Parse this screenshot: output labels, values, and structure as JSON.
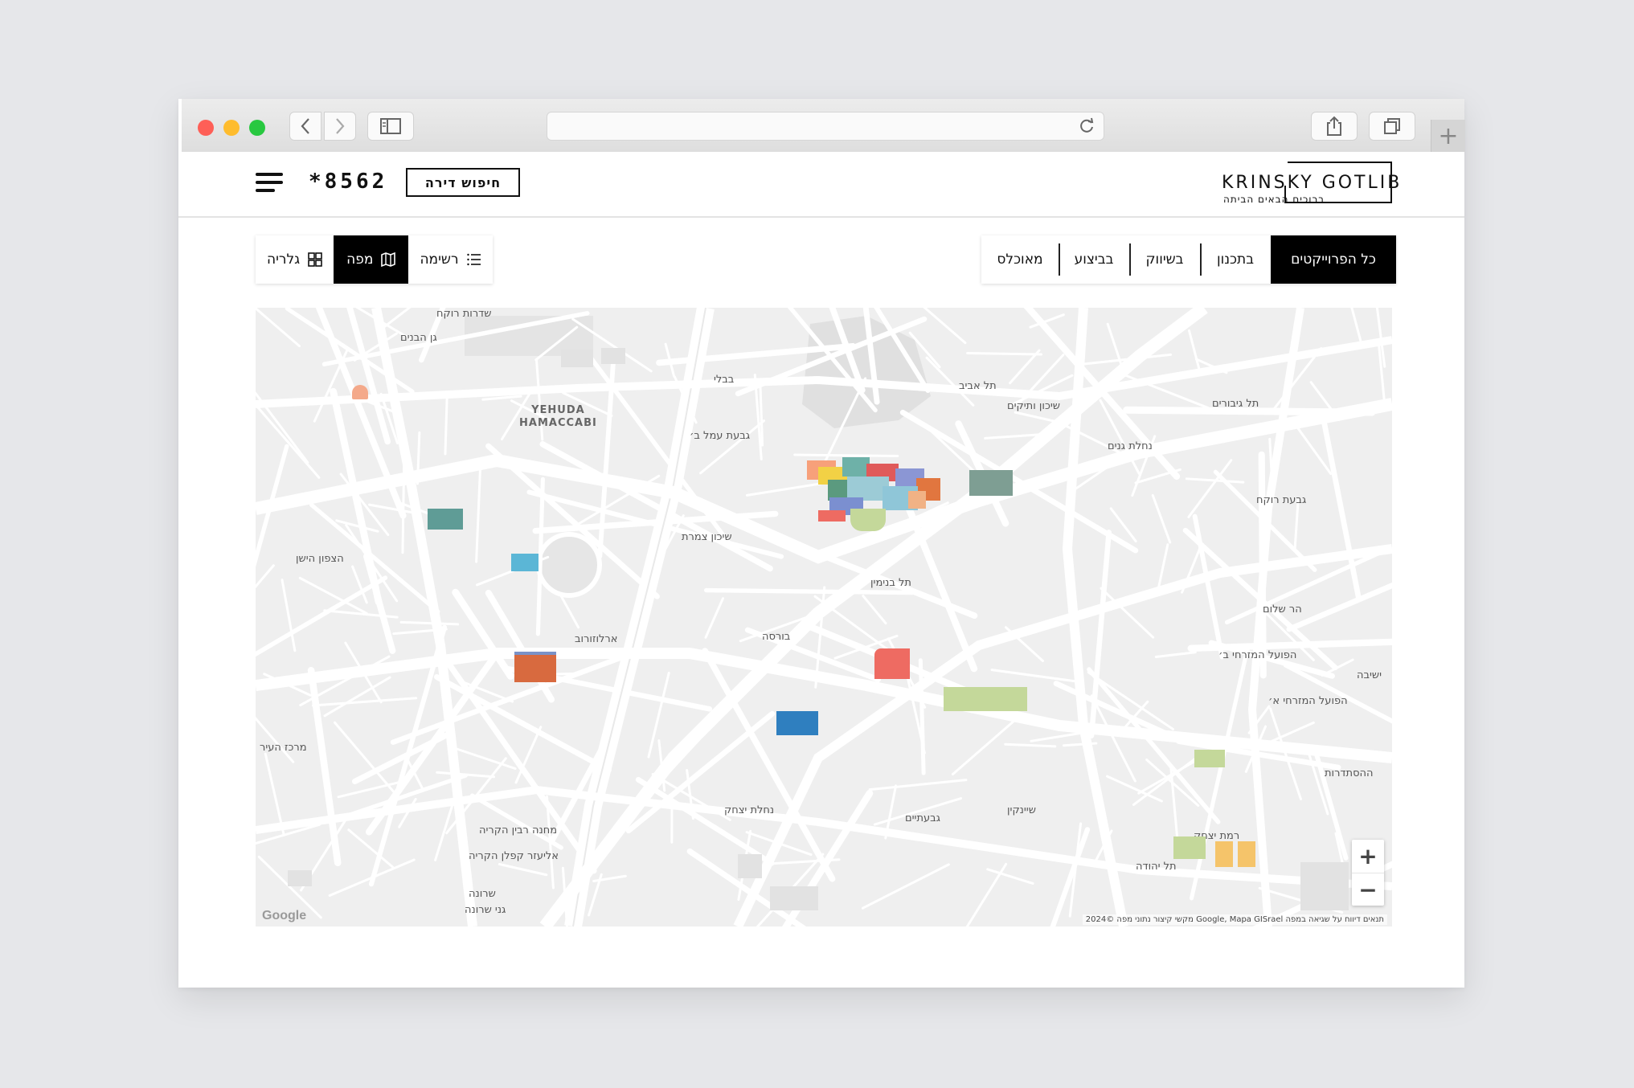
{
  "browser": {
    "url": "",
    "new_tab_symbol": "+"
  },
  "header": {
    "phone": "*8562",
    "search_button": "חיפוש דירה",
    "logo_name": "KRINSKY GOTLIB",
    "logo_tagline": "ברוכים הבאים הביתה"
  },
  "view_toggle": [
    {
      "label": "רשימה",
      "icon": "list-icon",
      "active": false
    },
    {
      "label": "מפה",
      "icon": "map-icon",
      "active": true
    },
    {
      "label": "גלריה",
      "icon": "grid-icon",
      "active": false
    }
  ],
  "filters": [
    {
      "label": "מאוכלס",
      "active": false
    },
    {
      "label": "בביצוע",
      "active": false
    },
    {
      "label": "בשיווק",
      "active": false
    },
    {
      "label": "בתכנון",
      "active": false
    },
    {
      "label": "כל הפרוייקטים",
      "active": true
    }
  ],
  "map": {
    "zoom_in": "+",
    "zoom_out": "−",
    "google": "Google",
    "attribution": "מקשי קיצור   נתוני מפה ©2024 Google, Mapa GISrael   תנאים   דיווח על שגיאה במפה",
    "labels": [
      "שדרות רוקח",
      "גן הבנים",
      "תל אביב",
      "שיכון ותיקים",
      "נחלת גנים",
      "בבלי",
      "גבעת עמל ב׳",
      "תל גיבורים",
      "גבעת רוקח",
      "הצפון הישן",
      "שיכון צמרת",
      "תל בנימין",
      "בורסה",
      "הר שלום",
      "הפועל המזרחי ב׳",
      "הפועל המזרחי א׳",
      "ארלוזורוב",
      "מרכז העיר",
      "מחנה רבין הקריה",
      "אליעזר קפלן הקריה",
      "נחלת יצחק",
      "גבעתיים",
      "שיינקין",
      "רמת יצחק",
      "תל יהודה",
      "שרונה",
      "גני שרונה",
      "ההסתדרות",
      "ישיבה"
    ],
    "labels_en": [
      "YEHUDA",
      "HAMACCABI"
    ],
    "projects_count": 15
  },
  "colors": {
    "accent": "#000000",
    "map_bg": "#efefef",
    "road": "#ffffff"
  }
}
